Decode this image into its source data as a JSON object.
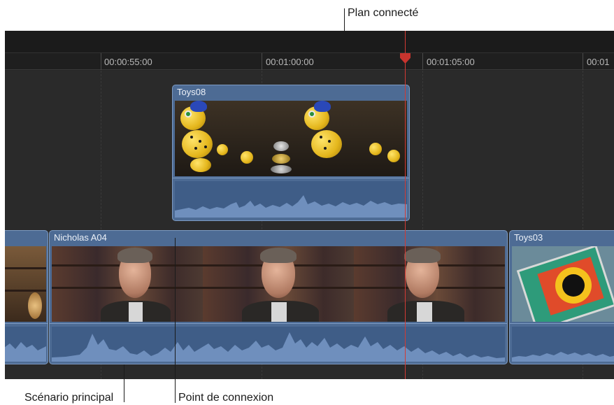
{
  "callouts": {
    "connected_clip": "Plan connecté",
    "primary_storyline": "Scénario principal",
    "connection_point": "Point de connexion"
  },
  "ruler": {
    "timecodes": [
      "00:00:55:00",
      "00:01:00:00",
      "00:01:05:00",
      "00:01"
    ]
  },
  "clips": {
    "connected": {
      "name": "Toys08"
    },
    "primary_main": {
      "name": "Nicholas A04"
    },
    "primary_next": {
      "name": "Toys03"
    }
  },
  "colors": {
    "clip_fill": "#4d6b94",
    "clip_border": "#7d9bc3",
    "playhead": "#d23a34",
    "timeline_bg": "#262626"
  }
}
